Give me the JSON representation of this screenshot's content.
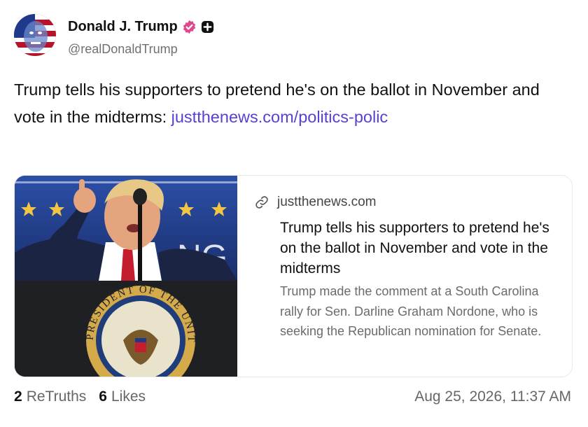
{
  "author": {
    "display_name": "Donald J. Trump",
    "handle": "@realDonaldTrump",
    "verified_icon": "verified-badge-icon",
    "verified_color": "#e0488e"
  },
  "post": {
    "text": "Trump tells his supporters to pretend he's on the ballot in November and vote in the midterms: ",
    "link_text": "justthenews.com/politics-polic",
    "link_color": "#5b3fd0"
  },
  "card": {
    "domain": "justthenews.com",
    "title": "Trump tells his supporters to pretend he's on the ballot in November and vote in the midterms",
    "description": "Trump made the comment at a South Carolina rally for Sen. Darline Graham Nordone, who is seeking the Republican nomination for Senate.",
    "image_letters": "NG",
    "seal_text": "PRESIDENT OF THE UNITED"
  },
  "stats": {
    "retruths_count": "2",
    "retruths_label": "ReTruths",
    "likes_count": "6",
    "likes_label": "Likes"
  },
  "timestamp": "Aug 25, 2026, 11:37 AM"
}
